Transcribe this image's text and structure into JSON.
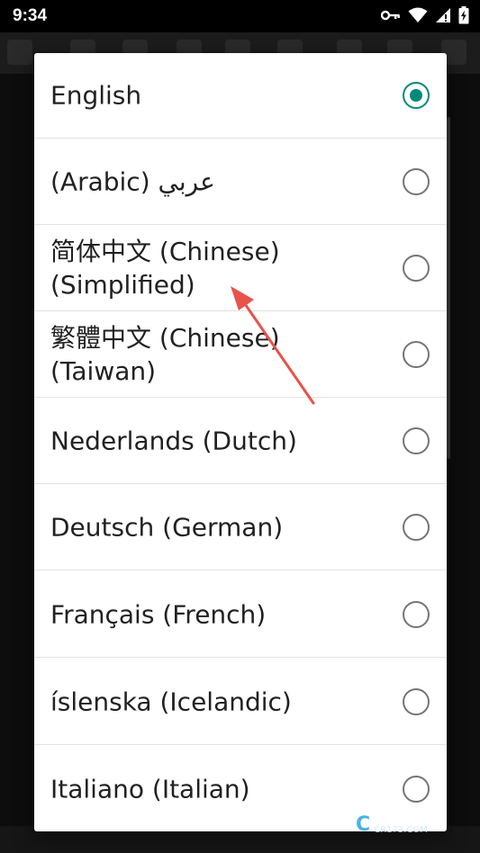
{
  "status_bar": {
    "time": "9:34",
    "icons": [
      "key-icon",
      "wifi-icon",
      "cellular-icon",
      "battery-icon"
    ]
  },
  "dialog": {
    "accent_color": "#00897b",
    "items": [
      {
        "label": "English",
        "selected": true
      },
      {
        "label": "(Arabic) عربي",
        "selected": false
      },
      {
        "label": "简体中文 (Chinese)\n(Simplified)",
        "selected": false
      },
      {
        "label": "繁體中文 (Chinese)\n(Taiwan)",
        "selected": false
      },
      {
        "label": "Nederlands (Dutch)",
        "selected": false
      },
      {
        "label": "Deutsch (German)",
        "selected": false
      },
      {
        "label": "Français (French)",
        "selected": false
      },
      {
        "label": "íslenska (Icelandic)",
        "selected": false
      },
      {
        "label": "Italiano (Italian)",
        "selected": false
      }
    ]
  },
  "annotation": {
    "icon": "red-arrow-icon",
    "color": "#e8534a"
  },
  "watermark": {
    "logo": "C",
    "brand": "西西软件园",
    "url": "CR173.COM"
  }
}
